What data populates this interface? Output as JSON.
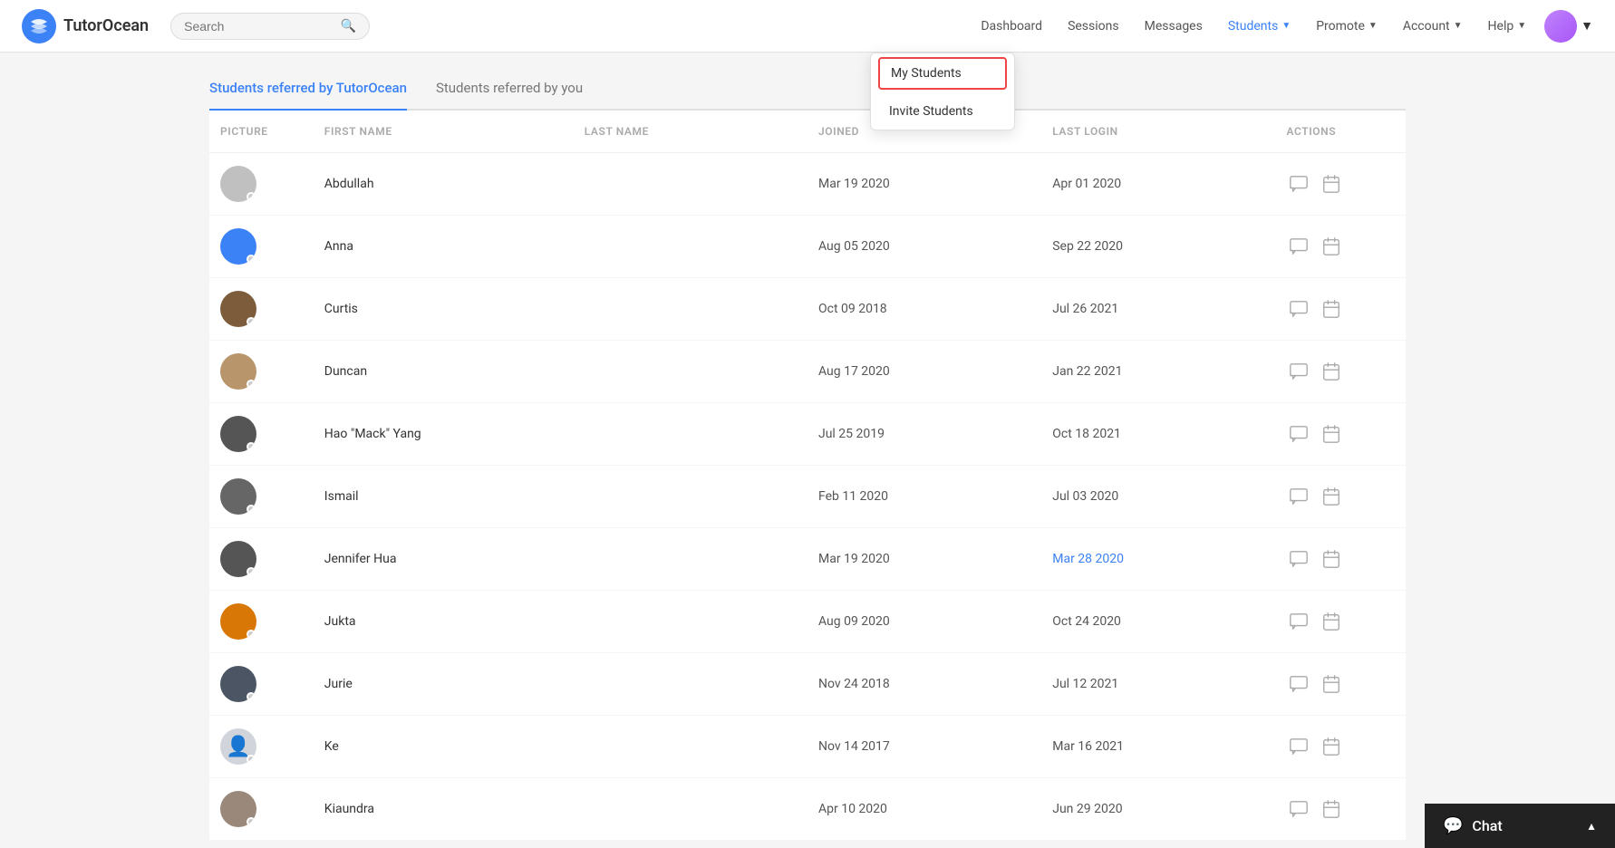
{
  "header": {
    "logo_text": "TutorOcean",
    "search_placeholder": "Search",
    "nav_items": [
      {
        "label": "Dashboard",
        "active": false,
        "has_dropdown": false
      },
      {
        "label": "Sessions",
        "active": false,
        "has_dropdown": false
      },
      {
        "label": "Messages",
        "active": false,
        "has_dropdown": false
      },
      {
        "label": "Students",
        "active": true,
        "has_dropdown": true
      },
      {
        "label": "Promote",
        "active": false,
        "has_dropdown": true
      },
      {
        "label": "Account",
        "active": false,
        "has_dropdown": true
      },
      {
        "label": "Help",
        "active": false,
        "has_dropdown": true
      }
    ]
  },
  "students_dropdown": {
    "items": [
      {
        "label": "My Students",
        "highlighted": true
      },
      {
        "label": "Invite Students",
        "highlighted": false
      }
    ]
  },
  "tabs": [
    {
      "label": "Students referred by TutorOcean",
      "active": true
    },
    {
      "label": "Students referred by you",
      "active": false
    }
  ],
  "table": {
    "columns": [
      "PICTURE",
      "FIRST NAME",
      "LAST NAME",
      "JOINED",
      "LAST LOGIN",
      "ACTIONS"
    ],
    "rows": [
      {
        "first_name": "Abdullah",
        "last_name": "",
        "joined": "Mar 19 2020",
        "last_login": "Apr 01 2020",
        "last_login_highlight": false,
        "avatar_color": "av-gray"
      },
      {
        "first_name": "Anna",
        "last_name": "",
        "joined": "Aug 05 2020",
        "last_login": "Sep 22 2020",
        "last_login_highlight": false,
        "avatar_color": "av-blue"
      },
      {
        "first_name": "Curtis",
        "last_name": "",
        "joined": "Oct 09 2018",
        "last_login": "Jul 26 2021",
        "last_login_highlight": false,
        "avatar_color": "av-brown"
      },
      {
        "first_name": "Duncan",
        "last_name": "",
        "joined": "Aug 17 2020",
        "last_login": "Jan 22 2021",
        "last_login_highlight": false,
        "avatar_color": "av-tan"
      },
      {
        "first_name": "Hao \"Mack\" Yang",
        "last_name": "",
        "joined": "Jul 25 2019",
        "last_login": "Oct 18 2021",
        "last_login_highlight": false,
        "avatar_color": "av-dark"
      },
      {
        "first_name": "Ismail",
        "last_name": "",
        "joined": "Feb 11 2020",
        "last_login": "Jul 03 2020",
        "last_login_highlight": false,
        "avatar_color": "av-darkgray"
      },
      {
        "first_name": "Jennifer Hua",
        "last_name": "",
        "joined": "Mar 19 2020",
        "last_login": "Mar 28 2020",
        "last_login_highlight": true,
        "avatar_color": "av-dark"
      },
      {
        "first_name": "Jukta",
        "last_name": "",
        "joined": "Aug 09 2020",
        "last_login": "Oct 24 2020",
        "last_login_highlight": false,
        "avatar_color": "av-gold"
      },
      {
        "first_name": "Jurie",
        "last_name": "",
        "joined": "Nov 24 2018",
        "last_login": "Jul 12 2021",
        "last_login_highlight": false,
        "avatar_color": "av-medium"
      },
      {
        "first_name": "Ke",
        "last_name": "",
        "joined": "Nov 14 2017",
        "last_login": "Mar 16 2021",
        "last_login_highlight": false,
        "avatar_color": "av-placeholder"
      },
      {
        "first_name": "Kiaundra",
        "last_name": "",
        "joined": "Apr 10 2020",
        "last_login": "Jun 29 2020",
        "last_login_highlight": false,
        "avatar_color": "av-light"
      }
    ]
  },
  "chat_bar": {
    "label": "Chat",
    "chevron": "▲"
  }
}
